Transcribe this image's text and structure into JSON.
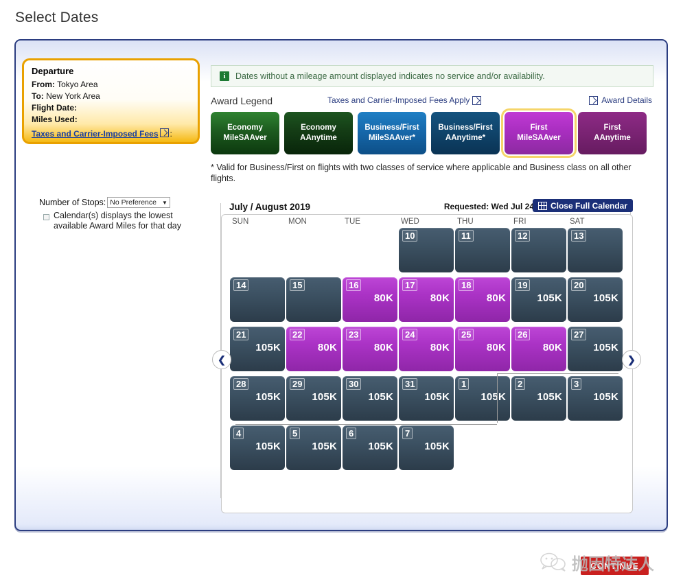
{
  "page_title": "Select Dates",
  "departure": {
    "heading": "Departure",
    "from_label": "From:",
    "from_value": "Tokyo Area",
    "to_label": "To:",
    "to_value": "New York Area",
    "flight_date_label": "Flight Date:",
    "flight_date_value": "",
    "miles_used_label": "Miles Used:",
    "miles_used_value": "",
    "fees_link": "Taxes and Carrier-Imposed Fees",
    "fees_link_suffix": ":"
  },
  "stops": {
    "label": "Number of Stops:",
    "selected": "No Preference",
    "caret": "▼",
    "options": [
      "No Preference"
    ]
  },
  "note": "Calendar(s) displays the lowest available Award Miles for that day",
  "info_bar": {
    "icon": "info-icon",
    "icon_glyph": "i",
    "text": "Dates without a mileage amount displayed indicates no service and/or availability."
  },
  "legend": {
    "title": "Award Legend",
    "fees_apply_link": "Taxes and Carrier-Imposed Fees Apply",
    "award_details_link": "Award Details",
    "chips": [
      {
        "line1": "Economy",
        "line2": "MileSAAver",
        "class": "c-econ-saver",
        "color": "#2f8331",
        "selected": false
      },
      {
        "line1": "Economy",
        "line2": "AAnytime",
        "class": "c-econ-any",
        "color": "#1d5520",
        "selected": false
      },
      {
        "line1": "Business/First",
        "line2": "MileSAAver*",
        "class": "c-bf-saver",
        "color": "#1f7fc4",
        "selected": false
      },
      {
        "line1": "Business/First",
        "line2": "AAnytime*",
        "class": "c-bf-any",
        "color": "#15537f",
        "selected": false
      },
      {
        "line1": "First",
        "line2": "MileSAAver",
        "class": "c-first-saver",
        "color": "#c03ad4",
        "selected": true
      },
      {
        "line1": "First",
        "line2": "AAnytime",
        "class": "c-first-any",
        "color": "#8e2a86",
        "selected": false
      }
    ],
    "footnote": "* Valid for Business/First on flights with two classes of service where applicable and Business class on all other flights."
  },
  "calendar": {
    "month_title": "July / August 2019",
    "requested": "Requested: Wed Jul 24",
    "close_button": "Close Full Calendar",
    "prev_arrow": "❮",
    "next_arrow": "❯",
    "day_headers": [
      "SUN",
      "MON",
      "TUE",
      "WED",
      "THU",
      "FRI",
      "SAT"
    ],
    "weeks": [
      [
        {
          "day": "",
          "miles": "",
          "state": "empty"
        },
        {
          "day": "",
          "miles": "",
          "state": "empty"
        },
        {
          "day": "",
          "miles": "",
          "state": "empty"
        },
        {
          "day": "10",
          "miles": "",
          "state": "blue"
        },
        {
          "day": "11",
          "miles": "",
          "state": "blue"
        },
        {
          "day": "12",
          "miles": "",
          "state": "blue"
        },
        {
          "day": "13",
          "miles": "",
          "state": "blue"
        }
      ],
      [
        {
          "day": "14",
          "miles": "",
          "state": "blue"
        },
        {
          "day": "15",
          "miles": "",
          "state": "blue"
        },
        {
          "day": "16",
          "miles": "80K",
          "state": "purple"
        },
        {
          "day": "17",
          "miles": "80K",
          "state": "purple"
        },
        {
          "day": "18",
          "miles": "80K",
          "state": "purple"
        },
        {
          "day": "19",
          "miles": "105K",
          "state": "blue"
        },
        {
          "day": "20",
          "miles": "105K",
          "state": "blue"
        }
      ],
      [
        {
          "day": "21",
          "miles": "105K",
          "state": "blue"
        },
        {
          "day": "22",
          "miles": "80K",
          "state": "purple"
        },
        {
          "day": "23",
          "miles": "80K",
          "state": "purple"
        },
        {
          "day": "24",
          "miles": "80K",
          "state": "purple"
        },
        {
          "day": "25",
          "miles": "80K",
          "state": "purple"
        },
        {
          "day": "26",
          "miles": "80K",
          "state": "purple"
        },
        {
          "day": "27",
          "miles": "105K",
          "state": "blue"
        }
      ],
      [
        {
          "day": "28",
          "miles": "105K",
          "state": "blue"
        },
        {
          "day": "29",
          "miles": "105K",
          "state": "blue"
        },
        {
          "day": "30",
          "miles": "105K",
          "state": "blue"
        },
        {
          "day": "31",
          "miles": "105K",
          "state": "blue"
        },
        {
          "day": "1",
          "miles": "105K",
          "state": "blue"
        },
        {
          "day": "2",
          "miles": "105K",
          "state": "blue"
        },
        {
          "day": "3",
          "miles": "105K",
          "state": "blue"
        }
      ],
      [
        {
          "day": "4",
          "miles": "105K",
          "state": "blue"
        },
        {
          "day": "5",
          "miles": "105K",
          "state": "blue"
        },
        {
          "day": "6",
          "miles": "105K",
          "state": "blue"
        },
        {
          "day": "7",
          "miles": "105K",
          "state": "blue"
        },
        {
          "day": "",
          "miles": "",
          "state": "empty"
        },
        {
          "day": "",
          "miles": "",
          "state": "empty"
        },
        {
          "day": "",
          "miles": "",
          "state": "empty"
        }
      ]
    ]
  },
  "footer": {
    "continue_label": "CONTINUE",
    "watermark_text": "抛因特达人"
  }
}
